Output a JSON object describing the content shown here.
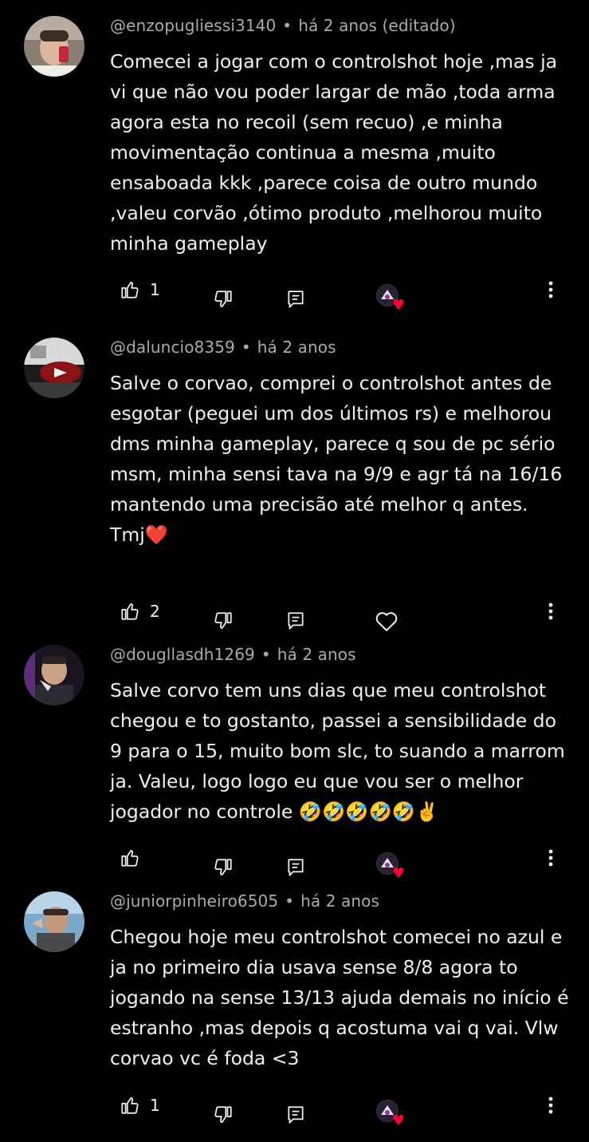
{
  "colors": {
    "background": "#000000",
    "text_primary": "#f1f1f1",
    "text_secondary": "#aaaaaa",
    "heart_red": "#ff0033"
  },
  "comments": [
    {
      "handle": "@enzopugliessi3140",
      "time": "há 2 anos (editado)",
      "text": "Comecei a jogar com o controlshot hoje ,mas ja vi que não vou poder largar de mão ,toda arma agora esta no recoil (sem recuo) ,e minha movimentação continua a mesma ,muito ensaboada kkk ,parece coisa de outro mundo ,valeu corvão ,ótimo produto ,melhorou muito minha gameplay",
      "likes": "1",
      "creator_hearted": true
    },
    {
      "handle": "@daluncio8359",
      "time": "há 2 anos",
      "text": "Salve o corvao, comprei o controlshot antes de esgotar (peguei um dos últimos rs) e melhorou dms minha gameplay, parece q sou de pc sério msm, minha sensi tava na 9/9 e agr tá na 16/16 mantendo uma precisão até melhor q antes.\nTmj❤️",
      "likes": "2",
      "creator_hearted": false
    },
    {
      "handle": "@dougllasdh1269",
      "time": "há 2 anos",
      "text": "Salve corvo tem uns dias que meu controlshot chegou e to gostanto, passei a sensibilidade do 9 para o 15, muito bom slc, to suando a marrom ja. Valeu, logo logo eu que vou ser o melhor jogador no controle 🤣🤣🤣🤣🤣✌️",
      "likes": "",
      "creator_hearted": true
    },
    {
      "handle": "@juniorpinheiro6505",
      "time": "há 2 anos",
      "text": "Chegou hoje meu controlshot comecei no azul e ja no primeiro dia usava sense 8/8 agora to jogando na sense 13/13 ajuda demais no início é estranho ,mas depois q acostuma vai q vai. Vlw corvao vc é foda <3",
      "likes": "1",
      "creator_hearted": true
    }
  ],
  "icons": {
    "like": "thumb-up-icon",
    "dislike": "thumb-down-icon",
    "reply": "reply-icon",
    "heart": "heart-outline-icon",
    "creator_heart": "creator-heart-icon",
    "more": "more-vert-icon"
  }
}
